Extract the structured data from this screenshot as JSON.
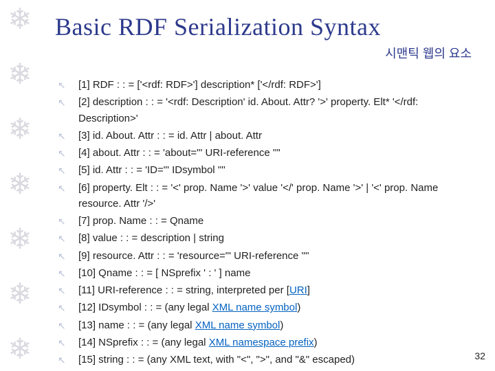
{
  "title": "Basic RDF Serialization Syntax",
  "subtitle": "시맨틱 웹의 요소",
  "page_number": "32",
  "bullet_glyph": "↖",
  "snowflake_glyph": "❄",
  "rules": [
    {
      "segments": [
        {
          "text": "[1] RDF : : = ['<rdf: RDF>'] description* ['</rdf: RDF>']"
        }
      ]
    },
    {
      "segments": [
        {
          "text": "[2] description : : = '<rdf: Description' id. About. Attr? '>' property. Elt* '</rdf: Description>'"
        }
      ]
    },
    {
      "segments": [
        {
          "text": "[3] id. About. Attr : : = id. Attr | about. Attr"
        }
      ]
    },
    {
      "segments": [
        {
          "text": "[4] about. Attr : : = 'about=\"' URI-reference '\"'"
        }
      ]
    },
    {
      "segments": [
        {
          "text": "[5] id. Attr : : = 'ID=\"' IDsymbol '\"'"
        }
      ]
    },
    {
      "segments": [
        {
          "text": "[6] property. Elt : : = '<' prop. Name '>' value '</' prop. Name '>' | '<' prop. Name resource. Attr '/>'"
        }
      ]
    },
    {
      "segments": [
        {
          "text": "[7] prop. Name : : = Qname"
        }
      ]
    },
    {
      "segments": [
        {
          "text": "[8] value : : = description | string"
        }
      ]
    },
    {
      "segments": [
        {
          "text": "[9] resource. Attr : : = 'resource=\"' URI-reference '\"'"
        }
      ]
    },
    {
      "segments": [
        {
          "text": "[10] Qname : : = [ NSprefix ' : ' ] name"
        }
      ]
    },
    {
      "segments": [
        {
          "text": "[11] URI-reference : : = string, interpreted per ["
        },
        {
          "text": "URI",
          "link": true
        },
        {
          "text": "]"
        }
      ]
    },
    {
      "segments": [
        {
          "text": "[12] IDsymbol : : = (any legal "
        },
        {
          "text": "XML name symbol",
          "link": true
        },
        {
          "text": ")"
        }
      ]
    },
    {
      "segments": [
        {
          "text": "[13] name : : = (any legal "
        },
        {
          "text": "XML name symbol",
          "link": true
        },
        {
          "text": ")"
        }
      ]
    },
    {
      "segments": [
        {
          "text": "[14] NSprefix : : = (any legal "
        },
        {
          "text": "XML namespace prefix",
          "link": true
        },
        {
          "text": ")"
        }
      ]
    },
    {
      "segments": [
        {
          "text": "[15] string : : = (any XML text, with \"<\", \">\", and \"&\" escaped)"
        }
      ]
    }
  ]
}
